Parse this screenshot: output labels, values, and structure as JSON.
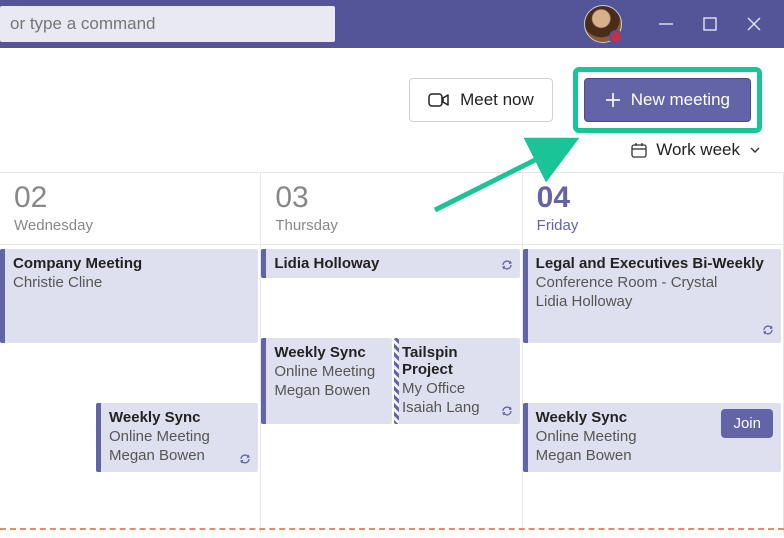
{
  "titlebar": {
    "search_placeholder": "or type a command"
  },
  "toolbar": {
    "meet_now_label": "Meet now",
    "new_meeting_label": "New meeting"
  },
  "subtoolbar": {
    "work_week_label": "Work week"
  },
  "days": [
    {
      "num": "02",
      "name": "Wednesday",
      "today": false,
      "top_events": [
        {
          "title": "Company Meeting",
          "sub": "",
          "org": "Christie Cline",
          "recurring": false
        }
      ],
      "row2": [
        {
          "title": "Weekly Sync",
          "sub": "Online Meeting",
          "org": "Megan Bowen",
          "recurring": true,
          "offset": true
        }
      ]
    },
    {
      "num": "03",
      "name": "Thursday",
      "today": false,
      "top_events": [
        {
          "title": "Lidia Holloway",
          "sub": "",
          "org": "",
          "recurring": true,
          "small": true
        }
      ],
      "row2": [
        {
          "title": "Weekly Sync",
          "sub": "Online Meeting",
          "org": "Megan Bowen",
          "recurring": false
        },
        {
          "title": "Tailspin Project",
          "sub": "My Office",
          "org": "Isaiah Lang",
          "recurring": true,
          "tentative": true
        }
      ]
    },
    {
      "num": "04",
      "name": "Friday",
      "today": true,
      "top_events": [
        {
          "title": "Legal and Executives Bi-Weekly",
          "sub": "Conference Room - Crystal",
          "org": "Lidia Holloway",
          "recurring": true
        }
      ],
      "row2": [
        {
          "title": "Weekly Sync",
          "sub": "Online Meeting",
          "org": "Megan Bowen",
          "recurring": false,
          "join": true
        }
      ]
    }
  ],
  "buttons": {
    "join": "Join"
  }
}
